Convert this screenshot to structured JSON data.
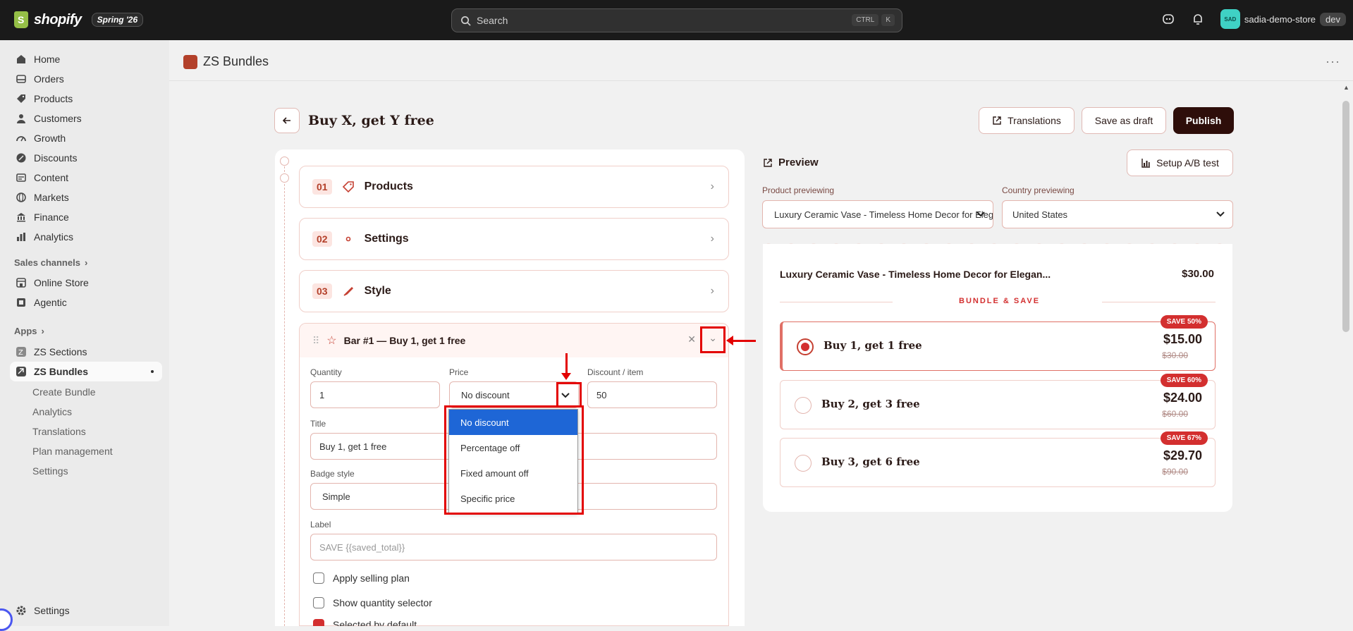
{
  "topbar": {
    "logo_text": "shopify",
    "release_tag": "Spring '26",
    "search_placeholder": "Search",
    "kbd_ctrl": "CTRL",
    "kbd_k": "K",
    "store_name": "sadia-demo-store",
    "avatar_initials": "SAD",
    "env_tag": "dev"
  },
  "sidebar": {
    "items": [
      {
        "label": "Home",
        "icon": "home-icon"
      },
      {
        "label": "Orders",
        "icon": "inbox-icon"
      },
      {
        "label": "Products",
        "icon": "tag-icon"
      },
      {
        "label": "Customers",
        "icon": "person-icon"
      },
      {
        "label": "Growth",
        "icon": "gauge-icon"
      },
      {
        "label": "Discounts",
        "icon": "discount-icon"
      },
      {
        "label": "Content",
        "icon": "content-icon"
      },
      {
        "label": "Markets",
        "icon": "globe-icon"
      },
      {
        "label": "Finance",
        "icon": "bank-icon"
      },
      {
        "label": "Analytics",
        "icon": "chart-icon"
      }
    ],
    "sales_channels_label": "Sales channels",
    "channels": [
      {
        "label": "Online Store"
      },
      {
        "label": "Agentic"
      }
    ],
    "apps_label": "Apps",
    "apps": [
      {
        "label": "ZS Sections"
      },
      {
        "label": "ZS Bundles"
      }
    ],
    "sub_items": [
      {
        "label": "Create Bundle"
      },
      {
        "label": "Analytics"
      },
      {
        "label": "Translations"
      },
      {
        "label": "Plan management"
      },
      {
        "label": "Settings"
      }
    ],
    "settings_label": "Settings"
  },
  "app": {
    "title": "ZS Bundles",
    "more": "···"
  },
  "page": {
    "title": "Buy X, get Y free",
    "translations_button": "Translations",
    "save_draft_button": "Save as draft",
    "publish_button": "Publish"
  },
  "steps": [
    {
      "num": "01",
      "label": "Products"
    },
    {
      "num": "02",
      "label": "Settings"
    },
    {
      "num": "03",
      "label": "Style"
    }
  ],
  "bar": {
    "title": "Bar #1 — Buy 1, get 1 free",
    "quantity_label": "Quantity",
    "quantity_value": "1",
    "price_label": "Price",
    "price_value": "No discount",
    "discount_label": "Discount / item",
    "discount_value": "50",
    "title_label": "Title",
    "title_value": "Buy 1, get 1 free",
    "badge_label": "Badge style",
    "badge_value": "Simple",
    "label_label": "Label",
    "label_placeholder": "SAVE {{saved_total}}",
    "apply_selling_plan": "Apply selling plan",
    "show_quantity_selector": "Show quantity selector",
    "selected_by_default": "Selected by default"
  },
  "price_dropdown": {
    "options": [
      "No discount",
      "Percentage off",
      "Fixed amount off",
      "Specific price"
    ],
    "selected_index": 0
  },
  "preview": {
    "heading": "Preview",
    "ab_button": "Setup A/B test",
    "product_label": "Product previewing",
    "product_value": "Luxury Ceramic Vase - Timeless Home Decor for Elegant",
    "country_label": "Country previewing",
    "country_value": "United States",
    "card_title": "Luxury Ceramic Vase - Timeless Home Decor for Elegan...",
    "card_price": "$30.00",
    "bundle_label": "BUNDLE & SAVE",
    "offers": [
      {
        "title": "Buy 1, get 1 free",
        "price": "$15.00",
        "old_price": "$30.00",
        "badge": "SAVE 50%",
        "selected": true
      },
      {
        "title": "Buy 2, get 3 free",
        "price": "$24.00",
        "old_price": "$60.00",
        "badge": "SAVE 60%",
        "selected": false
      },
      {
        "title": "Buy 3, get 6 free",
        "price": "$29.70",
        "old_price": "$90.00",
        "badge": "SAVE 67%",
        "selected": false
      }
    ]
  },
  "colors": {
    "accent": "#d32f2f",
    "publish": "#2e0e0a",
    "topbar": "#1a1a1a",
    "annotation_red": "#e30000"
  }
}
